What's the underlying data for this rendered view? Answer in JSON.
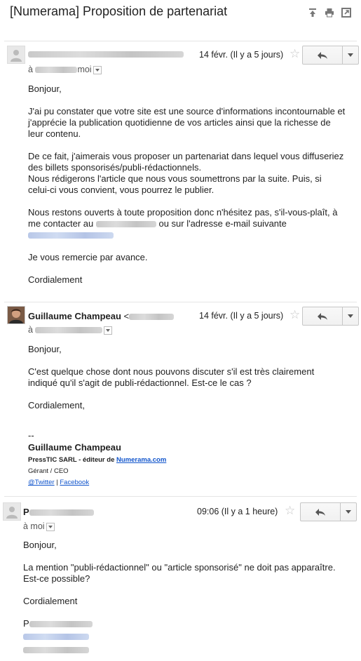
{
  "thread": {
    "subject": "[Numerama] Proposition de partenariat",
    "icons": [
      "expand-icon",
      "print-icon",
      "new-window-icon"
    ]
  },
  "messages": [
    {
      "sender": "",
      "date": "14 févr. (Il y a 5 jours)",
      "to_suffix": "moi",
      "reply_icon": "reply-icon",
      "body": [
        "Bonjour,",
        "J'ai pu constater que votre site est une source d'informations incontournable et",
        "j'apprécie la publication quotidienne de vos articles ainsi que la richesse de",
        "leur contenu.",
        "De ce fait, j'aimerais vous proposer un partenariat dans lequel vous diffuseriez",
        "des billets sponsorisés/publi-rédactionnels.",
        "Nous rédigerons l'article que nous vous soumettrons par la suite. Puis, si",
        "celui-ci vous convient, vous pourrez le publier.",
        "Nous restons ouverts à toute proposition donc n'hésitez pas, s'il-vous-plaît, à",
        "me contacter au",
        "ou sur l'adresse e-mail suivante",
        "Je vous remercie par avance.",
        "Cordialement"
      ]
    },
    {
      "sender": "Guillaume Champeau",
      "sender_email_prefix": "<",
      "date": "14 févr. (Il y a 5 jours)",
      "to_prefix": "à",
      "body": [
        "Bonjour,",
        "C'est quelque chose dont nous pouvons discuter s'il est très clairement",
        "indiqué qu'il s'agit de publi-rédactionnel. Est-ce le cas ?",
        "Cordialement,"
      ],
      "signature": {
        "dash": "--",
        "name": "Guillaume Champeau",
        "company_prefix": "PressTIC SARL - éditeur de ",
        "company_link": "Numerama.com",
        "role": "Gérant / CEO",
        "twitter": "@Twitter",
        "divider": "|",
        "facebook": "Facebook"
      }
    },
    {
      "sender_initial": "P",
      "date": "09:06 (Il y a 1 heure)",
      "to_line": "à moi",
      "body": [
        "Bonjour,",
        "La mention \"publi-rédactionnel\" ou \"article sponsorisé\" ne doit pas apparaître.",
        "Est-ce possible?",
        "Cordialement"
      ],
      "signature_initial": "P"
    }
  ]
}
